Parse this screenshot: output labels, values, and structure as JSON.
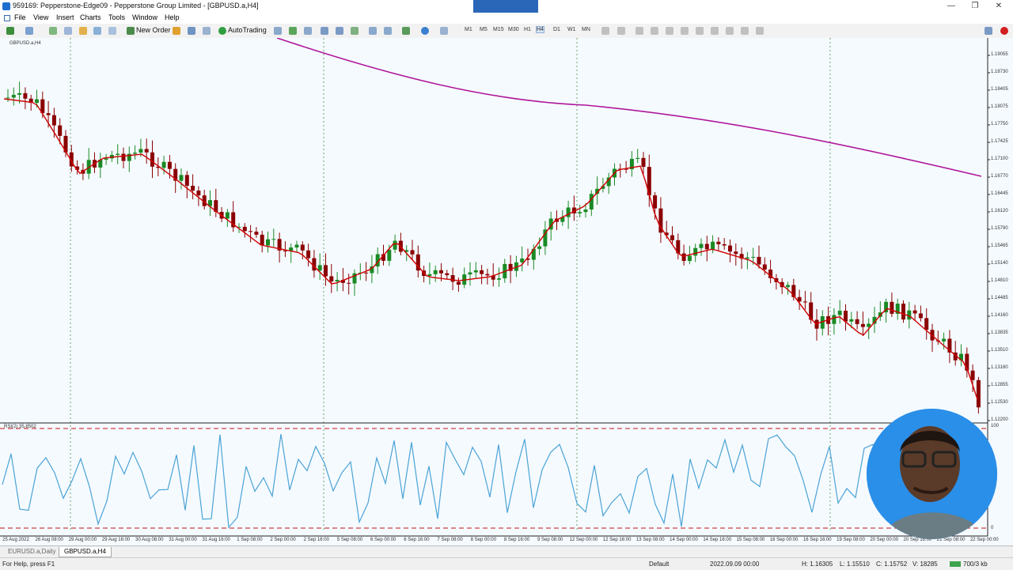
{
  "window": {
    "title": "959169: Pepperstone-Edge09 - Pepperstone Group Limited - [GBPUSD.a,H4]",
    "controls": [
      "—",
      "❐",
      "✕"
    ]
  },
  "menu": [
    "File",
    "View",
    "Insert",
    "Charts",
    "Tools",
    "Window",
    "Help"
  ],
  "toolbar": {
    "new_order_label": "New Order",
    "autotrading_label": "AutoTrading",
    "timeframes": [
      "M1",
      "M5",
      "M15",
      "M30",
      "H1",
      "H4",
      "D1",
      "W1",
      "MN"
    ]
  },
  "chart": {
    "symbol_label": "GBPUSD.a,H4",
    "rsi_label": "RSI(2) 35.8502",
    "price_labels": [
      "1.19055",
      "1.18730",
      "1.18405",
      "1.18075",
      "1.17750",
      "1.17425",
      "1.17100",
      "1.16770",
      "1.16445",
      "1.16120",
      "1.15790",
      "1.15465",
      "1.15140",
      "1.14810",
      "1.14485",
      "1.14160",
      "1.13835",
      "1.13510",
      "1.13180",
      "1.12855",
      "1.12530",
      "1.12200"
    ],
    "rsi_top_label": "100",
    "rsi_bottom_label": "0",
    "time_labels": [
      "25 Aug 2022",
      "26 Aug 08:00",
      "29 Aug 00:00",
      "29 Aug 16:00",
      "30 Aug 08:00",
      "31 Aug 00:00",
      "31 Aug 16:00",
      "1 Sep 08:00",
      "2 Sep 00:00",
      "2 Sep 16:00",
      "5 Sep 08:00",
      "6 Sep 00:00",
      "6 Sep 16:00",
      "7 Sep 08:00",
      "8 Sep 00:00",
      "8 Sep 16:00",
      "9 Sep 08:00",
      "12 Sep 00:00",
      "12 Sep 16:00",
      "13 Sep 08:00",
      "14 Sep 00:00",
      "14 Sep 16:00",
      "15 Sep 08:00",
      "16 Sep 00:00",
      "16 Sep 16:00",
      "19 Sep 08:00",
      "20 Sep 00:00",
      "20 Sep 16:00",
      "21 Sep 08:00",
      "22 Sep 00:00"
    ],
    "colors": {
      "background": "#f5faff",
      "bull": "#1a8a24",
      "bear": "#8b0000",
      "ema_fast": "#d00000",
      "ema_slow": "#b0169a",
      "rsi": "#4aa3d6",
      "rsi_levels": "#d04040",
      "separators": "#6fa06f"
    }
  },
  "chart_tabs": [
    "EURUSD.a,Daily",
    "GBPUSD.a,H4"
  ],
  "status": {
    "help": "For Help, press F1",
    "profile": "Default",
    "datetime": "2022.09.09 00:00",
    "high": "H: 1.16305",
    "low": "L: 1.15510",
    "close": "C: 1.15752",
    "volume": "V: 18285",
    "traffic": "700/3 kb"
  }
}
